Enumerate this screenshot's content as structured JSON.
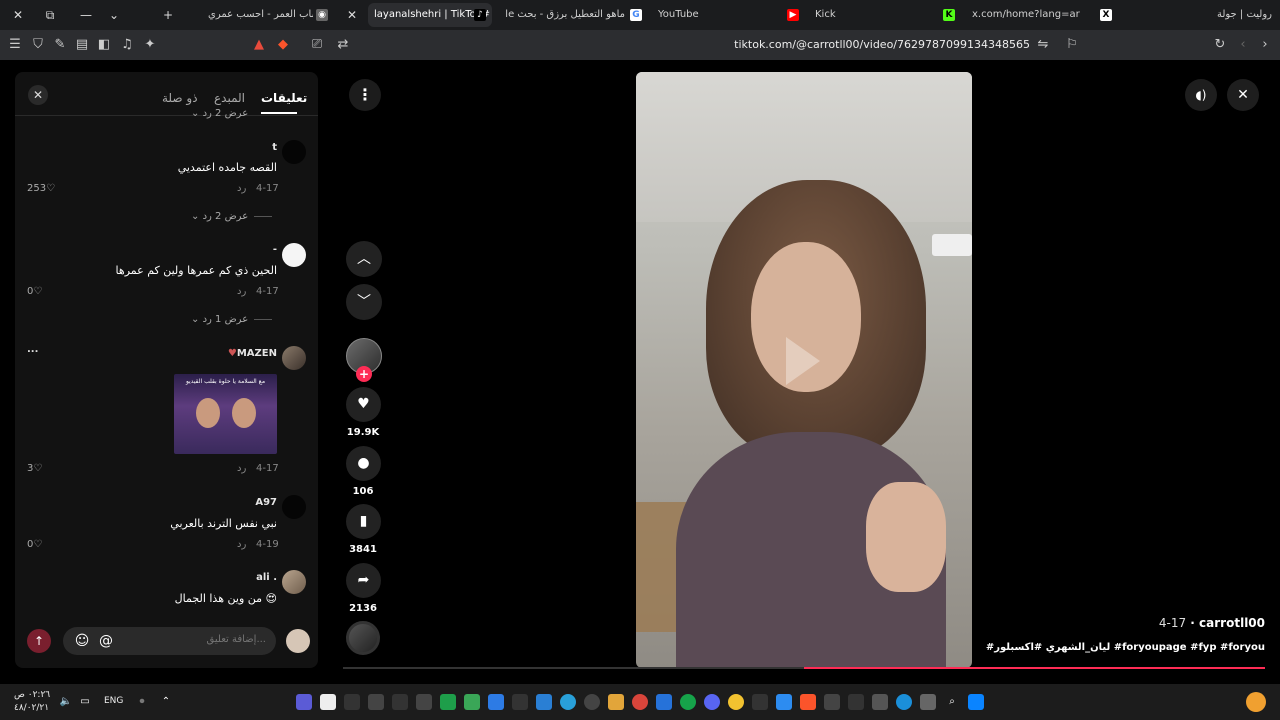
{
  "browser": {
    "tabs": [
      {
        "title": "حساب العمر - احسب عمري",
        "active": false
      },
      {
        "title": "layanalshehri | TikTok#",
        "active": true
      },
      {
        "title": "ماهو التعطيل برزق - بحث Google",
        "active": false
      },
      {
        "title": "YouTube",
        "active": false
      },
      {
        "title": "Kick",
        "active": false
      },
      {
        "title": "x.com/home?lang=ar",
        "active": false
      },
      {
        "title": "روليت | جولة",
        "active": false
      }
    ],
    "url": "tiktok.com/@carrotll00/video/7629787099134348565"
  },
  "comments_panel": {
    "tabs": [
      {
        "label": "تعليقات",
        "active": true
      },
      {
        "label": "المبدع",
        "active": false
      },
      {
        "label": "ذو صلة",
        "active": false
      }
    ],
    "top_replies_label": "عرض 2 رد",
    "comments": [
      {
        "user": "t",
        "text": "القصه جامده اعتمديي",
        "date": "4-17",
        "reply": "رد",
        "likes": "253",
        "replies_label": "عرض 2 رد"
      },
      {
        "user": "-",
        "text": "الحين ذي كم عمرها ولين كم عمرها",
        "date": "4-17",
        "reply": "رد",
        "likes": "0",
        "replies_label": "عرض 1 رد"
      },
      {
        "user": "MAZEN",
        "image_caption": "مع السلامة يا حلوة بقلب القيديو",
        "date": "4-17",
        "reply": "رد",
        "likes": "3",
        "more": "..."
      },
      {
        "user": "A97",
        "text": "نبي نفس الترند بالعربي",
        "date": "4-19",
        "reply": "رد",
        "likes": "0"
      },
      {
        "user": "ali .",
        "text": "من وين هذا الجمال 😍"
      }
    ],
    "input_placeholder": "إضافة تعليق...",
    "at_symbol": "@",
    "emoji_icon": "☺"
  },
  "video": {
    "actions": {
      "likes": "19.9K",
      "comments": "106",
      "bookmarks": "3841",
      "shares": "2136"
    },
    "author": "carrotll00",
    "date": "4-17",
    "separator": "·",
    "description": "#ليان_الشهري #اكسبلور #foryoupage #fyp #foryou",
    "progress_fraction": 0.5
  },
  "taskbar": {
    "time": "٠٢:٢٦ ص",
    "date": "٤٨/٠٢/٢١",
    "language": "ENG"
  },
  "colors": {
    "accent": "#fe2c55",
    "panel_bg": "#121212",
    "page_bg": "#000000"
  }
}
